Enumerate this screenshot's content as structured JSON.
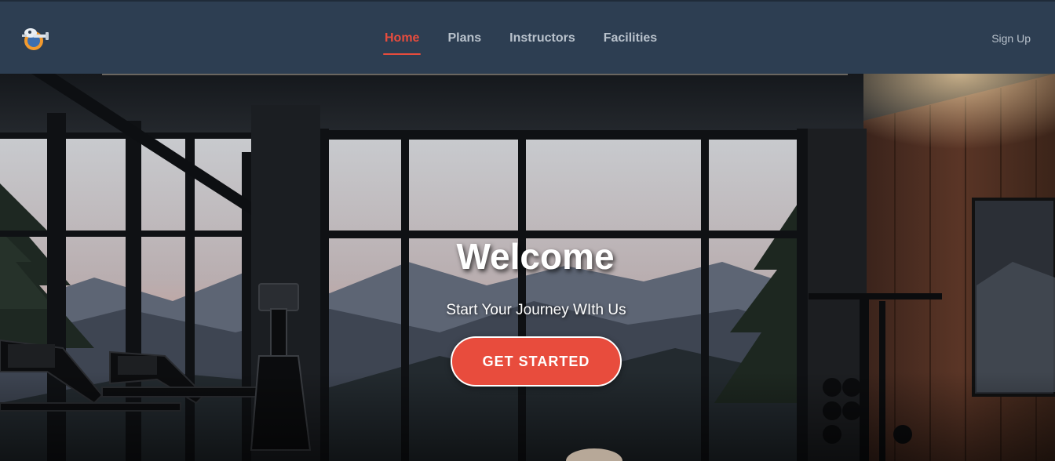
{
  "navbar": {
    "logo_icon": "gym-mascot-logo-icon",
    "links": [
      {
        "label": "Home",
        "active": true
      },
      {
        "label": "Plans",
        "active": false
      },
      {
        "label": "Instructors",
        "active": false
      },
      {
        "label": "Facilities",
        "active": false
      }
    ],
    "signup_label": "Sign Up"
  },
  "hero": {
    "title": "Welcome",
    "subtitle": "Start Your Journey WIth Us",
    "cta_label": "GET STARTED",
    "background_image": "gym-interior-mountain-view-image"
  },
  "colors": {
    "navbar_bg": "#2d3e52",
    "accent": "#e84c3d",
    "nav_text": "#b9c2cc"
  }
}
